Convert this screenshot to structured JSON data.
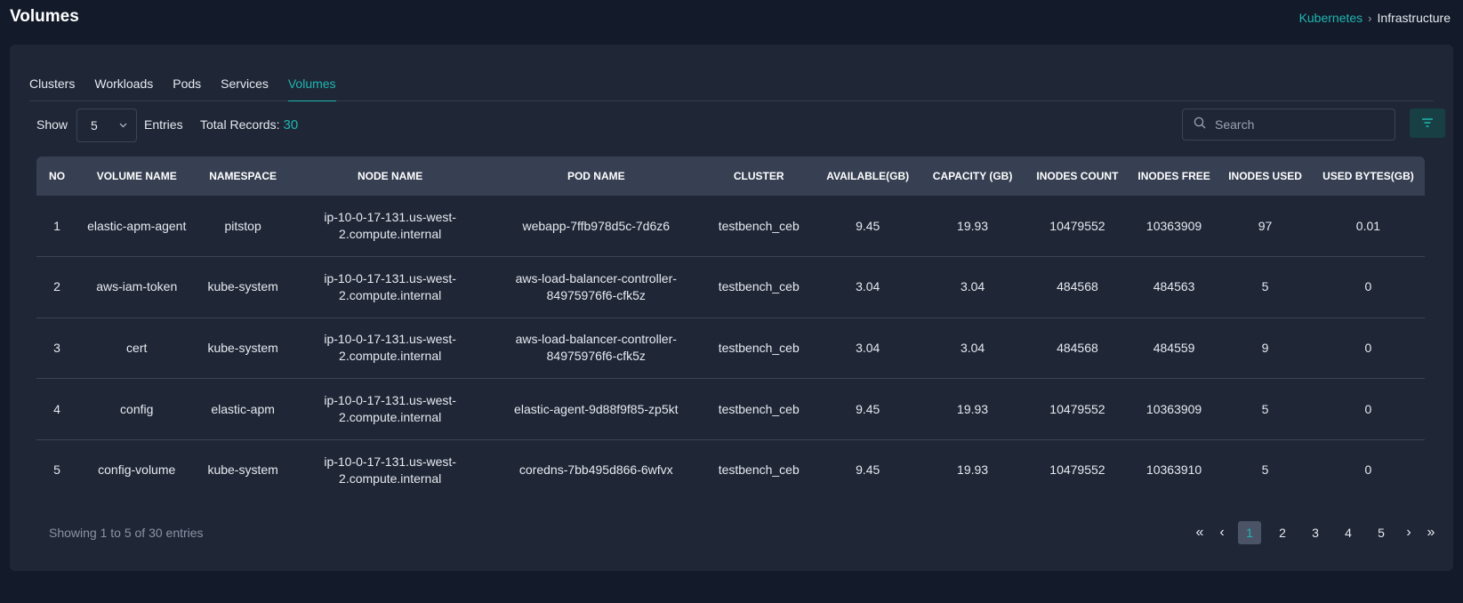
{
  "header": {
    "title": "Volumes",
    "breadcrumb": {
      "parent": "Kubernetes",
      "separator": "›",
      "current": "Infrastructure"
    }
  },
  "tabs": [
    {
      "label": "Clusters",
      "active": false
    },
    {
      "label": "Workloads",
      "active": false
    },
    {
      "label": "Pods",
      "active": false
    },
    {
      "label": "Services",
      "active": false
    },
    {
      "label": "Volumes",
      "active": true
    }
  ],
  "controls": {
    "show_label": "Show",
    "page_size": "5",
    "entries_label": "Entries",
    "total_label": "Total Records:",
    "total_count": "30",
    "search_placeholder": "Search",
    "search_value": ""
  },
  "table": {
    "columns": [
      "NO",
      "VOLUME NAME",
      "NAMESPACE",
      "NODE NAME",
      "POD NAME",
      "CLUSTER",
      "AVAILABLE(GB)",
      "CAPACITY (GB)",
      "INODES COUNT",
      "INODES FREE",
      "INODES USED",
      "USED BYTES(GB)"
    ],
    "rows": [
      [
        "1",
        "elastic-apm-agent",
        "pitstop",
        "ip-10-0-17-131.us-west-2.compute.internal",
        "webapp-7ffb978d5c-7d6z6",
        "testbench_ceb",
        "9.45",
        "19.93",
        "10479552",
        "10363909",
        "97",
        "0.01"
      ],
      [
        "2",
        "aws-iam-token",
        "kube-system",
        "ip-10-0-17-131.us-west-2.compute.internal",
        "aws-load-balancer-controller-84975976f6-cfk5z",
        "testbench_ceb",
        "3.04",
        "3.04",
        "484568",
        "484563",
        "5",
        "0"
      ],
      [
        "3",
        "cert",
        "kube-system",
        "ip-10-0-17-131.us-west-2.compute.internal",
        "aws-load-balancer-controller-84975976f6-cfk5z",
        "testbench_ceb",
        "3.04",
        "3.04",
        "484568",
        "484559",
        "9",
        "0"
      ],
      [
        "4",
        "config",
        "elastic-apm",
        "ip-10-0-17-131.us-west-2.compute.internal",
        "elastic-agent-9d88f9f85-zp5kt",
        "testbench_ceb",
        "9.45",
        "19.93",
        "10479552",
        "10363909",
        "5",
        "0"
      ],
      [
        "5",
        "config-volume",
        "kube-system",
        "ip-10-0-17-131.us-west-2.compute.internal",
        "coredns-7bb495d866-6wfvx",
        "testbench_ceb",
        "9.45",
        "19.93",
        "10479552",
        "10363910",
        "5",
        "0"
      ]
    ]
  },
  "footer": {
    "showing_text": "Showing 1 to 5 of 30 entries",
    "pages": [
      "1",
      "2",
      "3",
      "4",
      "5"
    ],
    "current_page": "1",
    "first_icon": "«",
    "prev_icon": "‹",
    "next_icon": "›",
    "last_icon": "»"
  },
  "icons": {
    "search": "search-icon",
    "filter": "filter-icon",
    "dropdown": "chevron-down-icon"
  },
  "colors": {
    "accent": "#1fb5b0",
    "background": "#131a2a",
    "card": "#1f2737",
    "header_row": "#364052"
  }
}
